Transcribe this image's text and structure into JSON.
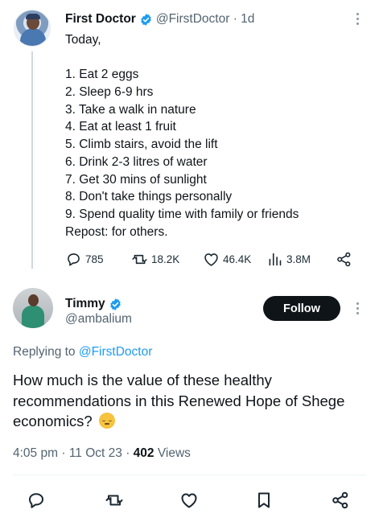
{
  "parent_tweet": {
    "author_name": "First Doctor",
    "author_handle": "@FirstDoctor",
    "time_ago": "1d",
    "separator": "·",
    "text_lines": [
      "Today,",
      "",
      "1. Eat 2 eggs",
      "2. Sleep 6-9 hrs",
      "3. Take a walk in nature",
      "4. Eat at least 1 fruit",
      "5. Climb stairs, avoid the lift",
      "6. Drink 2-3 litres of water",
      "7. Get 30 mins of sunlight",
      "8. Don't take things personally",
      "9. Spend quality time with family or friends",
      "Repost: for others."
    ],
    "stats": {
      "replies": "785",
      "reposts": "18.2K",
      "likes": "46.4K",
      "views": "3.8M"
    }
  },
  "reply_tweet": {
    "author_name": "Timmy",
    "author_handle": "@ambalium",
    "follow_label": "Follow",
    "replying_prefix": "Replying to",
    "replying_to": "@FirstDoctor",
    "text": "How much is the value of these healthy recommendations in this Renewed Hope of Shege economics?",
    "time": "4:05 pm",
    "date": "11 Oct 23",
    "separator": "·",
    "views_count": "402",
    "views_label": "Views"
  },
  "icons": {
    "verified": "verified-badge-icon",
    "reply": "reply-icon",
    "repost": "repost-icon",
    "like": "heart-icon",
    "views": "views-chart-icon",
    "share": "share-icon",
    "bookmark": "bookmark-icon",
    "more": "more-vertical-icon"
  },
  "colors": {
    "accent": "#1d9bf0",
    "text": "#0f1419",
    "secondary_text": "#536471",
    "follow_bg": "#0f1419"
  }
}
